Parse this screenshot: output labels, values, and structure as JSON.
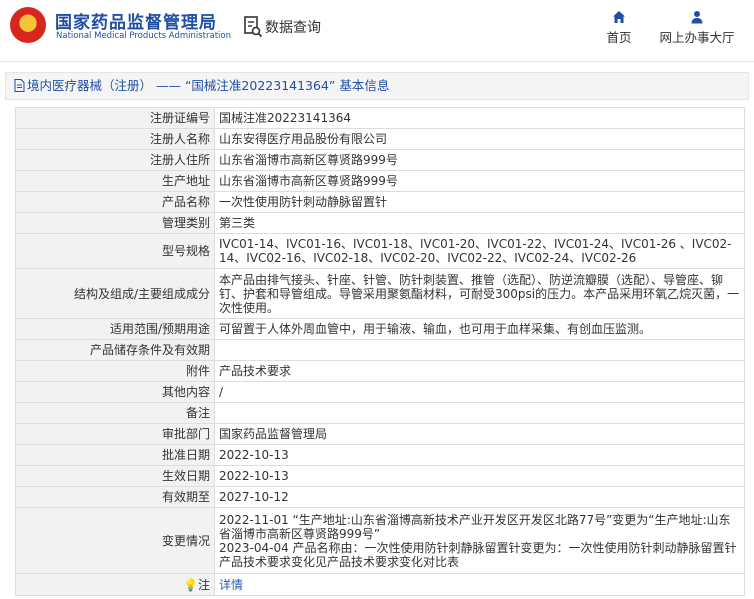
{
  "header": {
    "logo_cn": "国家药品监督管理局",
    "logo_en": "National Medical Products Administration",
    "data_query": "数据查询",
    "nav": [
      {
        "label": "首页",
        "icon": "home-icon"
      },
      {
        "label": "网上办事大厅",
        "icon": "user-icon"
      }
    ]
  },
  "page": {
    "breadcrumb": "境内医疗器械（注册） —— “国械注准20223141364” 基本信息"
  },
  "rows": [
    {
      "key": "注册证编号",
      "value": "国械注准20223141364"
    },
    {
      "key": "注册人名称",
      "value": "山东安得医疗用品股份有限公司"
    },
    {
      "key": "注册人住所",
      "value": "山东省淄博市高新区尊贤路999号"
    },
    {
      "key": "生产地址",
      "value": "山东省淄博市高新区尊贤路999号"
    },
    {
      "key": "产品名称",
      "value": "一次性使用防针刺动静脉留置针"
    },
    {
      "key": "管理类别",
      "value": "第三类"
    },
    {
      "key": "型号规格",
      "value": "IVC01-14、IVC01-16、IVC01-18、IVC01-20、IVC01-22、IVC01-24、IVC01-26 、IVC02-14、IVC02-16、IVC02-18、IVC02-20、IVC02-22、IVC02-24、IVC02-26"
    },
    {
      "key": "结构及组成/主要组成成分",
      "value": "本产品由排气接头、针座、针管、防针刺装置、推管（选配）、防逆流瓣膜（选配）、导管座、铆钉、护套和导管组成。导管采用聚氨酯材料，可耐受300psi的压力。本产品采用环氧乙烷灭菌，一次性使用。"
    },
    {
      "key": "适用范围/预期用途",
      "value": "可留置于人体外周血管中，用于输液、输血，也可用于血样采集、有创血压监测。"
    },
    {
      "key": "产品储存条件及有效期",
      "value": ""
    },
    {
      "key": "附件",
      "value": "产品技术要求"
    },
    {
      "key": "其他内容",
      "value": "/"
    },
    {
      "key": "备注",
      "value": ""
    },
    {
      "key": "审批部门",
      "value": "国家药品监督管理局"
    },
    {
      "key": "批准日期",
      "value": "2022-10-13"
    },
    {
      "key": "生效日期",
      "value": "2022-10-13"
    },
    {
      "key": "有效期至",
      "value": "2027-10-12"
    },
    {
      "key": "变更情况",
      "value": "2022-11-01 “生产地址:山东省淄博高新技术产业开发区开发区北路77号”变更为“生产地址:山东省淄博市高新区尊贤路999号”\n2023-04-04 产品名称由：一次性使用防针刺静脉留置针变更为：一次性使用防针刺动静脉留置针\n产品技术要求变化见产品技术要求变化对比表"
    },
    {
      "key": "注",
      "value": "详情"
    }
  ],
  "colors": {
    "brand_blue": "#1f4fa3",
    "key_bg": "#f2f2f2",
    "link": "#1f5fb0"
  }
}
